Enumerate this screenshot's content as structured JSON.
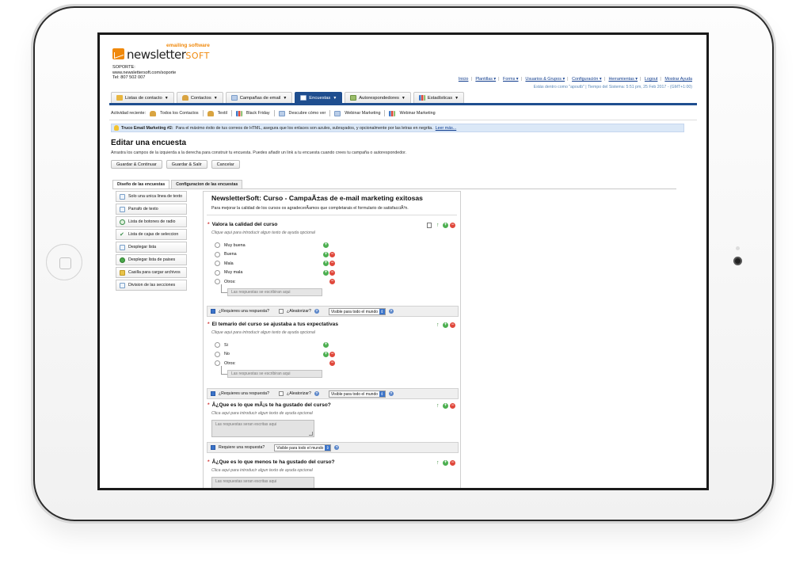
{
  "brand": {
    "tagline": "emailing software",
    "name_main": "newsletter",
    "name_suffix": "SOFT",
    "support_lines": [
      "SOPORTE:",
      "www.newslettersoft.com/soporte",
      "Tel: 807 502 007"
    ]
  },
  "top_links": [
    "Inicio",
    "Plantillas ▾",
    "Forms ▾",
    "Usuarios & Grupos ▾",
    "Configuración ▾",
    "Herramientas ▾",
    "Logout",
    "Mostrar Ayuda"
  ],
  "status_line": "Estás dentro como \"apoutb\" | Tiempo del Sistema: 5:51 pm, 25 Feb 2017 - (GMT+1:00)",
  "main_tabs": [
    {
      "label": "Listas de contacto",
      "icon": "folder-icon",
      "active": false
    },
    {
      "label": "Contactos",
      "icon": "contacts-icon",
      "active": false
    },
    {
      "label": "Campañas de email",
      "icon": "email-icon",
      "active": false
    },
    {
      "label": "Encuestas",
      "icon": "survey-icon",
      "active": true
    },
    {
      "label": "Autorespondedores",
      "icon": "autoresponder-icon",
      "active": false
    },
    {
      "label": "Estadísticas",
      "icon": "stats-icon",
      "active": false
    }
  ],
  "recent": {
    "label": "Actividad reciente:",
    "items": [
      {
        "label": "Todos los Contactos",
        "icon": "contacts-icon"
      },
      {
        "label": "Textil",
        "icon": "contacts-icon"
      },
      {
        "label": "Black Friday",
        "icon": "stats-icon"
      },
      {
        "label": "Descubre cómo ver",
        "icon": "email-icon"
      },
      {
        "label": "Webinar Marketing",
        "icon": "email-icon"
      },
      {
        "label": "Webinar Marketing",
        "icon": "stats-icon"
      }
    ]
  },
  "tip": {
    "strong": "Truco Email Marketing #2:",
    "text": "Para el máximo éxito de tus correos de HTML, asegura que los enlaces son azules, subrayados, y opcionalmente por las letras en negrita.",
    "link": "Leer más..."
  },
  "page": {
    "title": "Editar una encuesta",
    "description": "Arrastra los campos de la izquierda a la derecha para construir tu encuesta. Puedes añadir un link a tu encuesta cuando crees tu campaña o autorespondedor.",
    "buttons": [
      "Guardar & Continuar",
      "Guardar & Salir",
      "Cancelar"
    ]
  },
  "sub_tabs": [
    "Diseño de las encuestas",
    "Configuracion de las encuestas"
  ],
  "palette": [
    {
      "label": "Solo una unica linea de texto",
      "icon": "text-line-icon"
    },
    {
      "label": "Parrafo de texto",
      "icon": "paragraph-icon"
    },
    {
      "label": "Lista de botones de radio",
      "icon": "radio-icon"
    },
    {
      "label": "Lista de cajas de seleccion",
      "icon": "checkbox-icon"
    },
    {
      "label": "Desplegar lista",
      "icon": "dropdown-icon"
    },
    {
      "label": "Desplegar lista de paises",
      "icon": "globe-icon"
    },
    {
      "label": "Casilla para cargar archivos",
      "icon": "upload-icon"
    },
    {
      "label": "Division de las secciones",
      "icon": "divider-icon"
    }
  ],
  "survey": {
    "title": "NewsletterSoft: Curso - CampaÃ±as de e-mail marketing exitosas",
    "subtitle": "Para mejorar la calidad de los cursos os agradecerÃ­amos que completarais el formulario de satisfacciÃ³n.",
    "q1": {
      "title": "Valora la calidad del curso",
      "help": "Clique aqui para introducir algun texto de ayuda opcional",
      "options": [
        "Muy buena",
        "Buena",
        "Mala",
        "Muy mala",
        "Otros:"
      ],
      "answer_note": "Las respuestas se escribiran aqui",
      "required_label": "¿Requieres una respuesta?",
      "random_label": "¿Aleatorizar?",
      "visibility": "Visible para todo el mundo"
    },
    "q2": {
      "title": "El temario del curso se ajustaba a tus expectativas",
      "help": "Clique aqui para introducir algun texto de ayuda opcional",
      "options": [
        "Si",
        "No",
        "Otros:"
      ],
      "answer_note": "Las respuestas se escribiran aqui",
      "required_label": "¿Requieres una respuesta?",
      "random_label": "¿Aleatorizar?",
      "visibility": "Visible para todo el mundo"
    },
    "q3": {
      "title": "Â¿Que es lo que mÃ¡s te ha gustado del curso?",
      "help": "Clica aqui para introducir algun texto de ayuda opcional",
      "answer_note": "Las respuestas seran escritas aqui",
      "required_label": "Requiere una respuesta?",
      "visibility": "Visible para todo el mundo"
    },
    "q4": {
      "title": "Â¿Que es lo que menos te ha gustado del curso?",
      "help": "Clica aqui para introducir algun texto de ayuda opcional",
      "answer_note": "Las respuestas seran escritas aqui"
    }
  }
}
